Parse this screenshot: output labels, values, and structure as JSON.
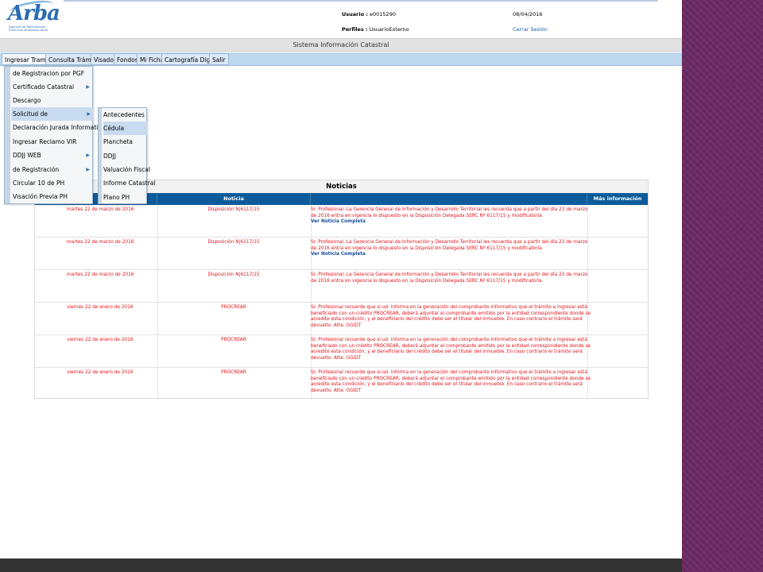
{
  "header": {
    "logo_text": "Arba",
    "logo_subtitle": "Agencia de Recaudación Provincia de Buenos Aires",
    "user_label": "Usuario :",
    "user_value": "e0015290",
    "profile_label": "Perfiles :",
    "profile_value": "UsuarioExterno",
    "date": "08/04/2016",
    "logout": "Cerrar Sesión"
  },
  "system_title": "Sistema Información Catastral",
  "menubar": [
    "Ingresar Tramite",
    "Consulta Trámite",
    "Visados",
    "Fondos",
    "Mi Ficha",
    "Cartografía Digital",
    "Salir"
  ],
  "dropdown": [
    {
      "label": "de Registracion por PGF",
      "arrow": ""
    },
    {
      "label": "Certificado Catastral",
      "arrow": "▶"
    },
    {
      "label": "Descargo",
      "arrow": ""
    },
    {
      "label": "Solicitud de",
      "arrow": "▶"
    },
    {
      "label": "Declaración Jurada Informativa",
      "arrow": ""
    },
    {
      "label": "Ingresar Reclamo VIR",
      "arrow": ""
    },
    {
      "label": "DDJJ WEB",
      "arrow": "▶"
    },
    {
      "label": "de Registración",
      "arrow": "▶"
    },
    {
      "label": "Circular 10 de PH",
      "arrow": ""
    },
    {
      "label": "Visación Previa PH",
      "arrow": ""
    }
  ],
  "submenu": [
    "Antecedentes",
    "Cédula",
    "Plancheta",
    "DDJJ",
    "Valuación Fiscal",
    "Informe Catastral",
    "Plano PH"
  ],
  "news": {
    "title": "Noticias",
    "columns": [
      "Noticia",
      "",
      "Más información"
    ],
    "rows": [
      {
        "date": "martes 22 de marzo de 2016",
        "tipo": "Disposición N|6117/15",
        "msg": "Sr. Profesional: La Gerencia General de Información y Desarrollo Territorial les recuerda que a partir del día 23 de marzo de 2016 entra en vigencia lo dispuesto en la Disposición Delegada SERC Nº 6117/15 y modificatoria",
        "link": "Ver Noticia Completa"
      },
      {
        "date": "martes 22 de marzo de 2016",
        "tipo": "Disposición N|6117/15",
        "msg": "Sr. Profesional: La Gerencia General de Información y Desarrollo Territorial les recuerda que a partir del día 23 de marzo de 2016 entra en vigencia lo dispuesto en la Disposición Delegada SERC Nº 6117/15 y modificatoria",
        "link": "Ver Noticia Completa"
      },
      {
        "date": "martes 22 de marzo de 2016",
        "tipo": "Disposición N|6117/15",
        "msg": "Sr. Profesional: La Gerencia General de Información y Desarrollo Territorial les recuerda que a partir del día 23 de marzo de 2016 entra en vigencia lo dispuesto en la Disposición Delegada SERC Nº 6117/15 y modificatoria",
        "link": ""
      },
      {
        "date": "viernes 22 de enero de 2016",
        "tipo": "PROCREAR",
        "msg": "Sr. Profesional recuerde que si ud. informa en la generación del comprobante informativo que el trámite a ingresar está beneficiado con un crédito PROCREAR, deberá adjuntar el comprobante emitido por la entidad correspondiente donde se acredite esta condición, y el beneficiario del crédito debe ser el titular del inmueble. En caso contrario el trámite será devuelto. Atte. GGIDT",
        "link": ""
      },
      {
        "date": "viernes 22 de enero de 2016",
        "tipo": "PROCREAR",
        "msg": "Sr. Profesional recuerde que si ud. informa en la generación del comprobante informativo que el trámite a ingresar está beneficiado con un crédito PROCREAR, deberá adjuntar el comprobante emitido por la entidad correspondiente donde se acredite esta condición, y el beneficiario del crédito debe ser el titular del inmueble. En caso contrario el trámite será devuelto. Atte. GGIDT",
        "link": ""
      },
      {
        "date": "viernes 22 de enero de 2016",
        "tipo": "PROCREAR",
        "msg": "Sr. Profesional recuerde que si ud. informa en la generación del comprobante informativo que el trámite a ingresar está beneficiado con un crédito PROCREAR, deberá adjuntar el comprobante emitido por la entidad correspondiente donde se acredite esta condición, y el beneficiario del crédito debe ser el titular del inmueble. En caso contrario el trámite será devuelto. Atte. GGIDT",
        "link": ""
      }
    ]
  },
  "colors": {
    "brand": "#2a6db0",
    "table_header": "#0d5b9a",
    "news_text": "#e0141a",
    "link": "#1a4e9a",
    "menubar": "#bcd7ee",
    "side_panel": "#6b2a63"
  }
}
